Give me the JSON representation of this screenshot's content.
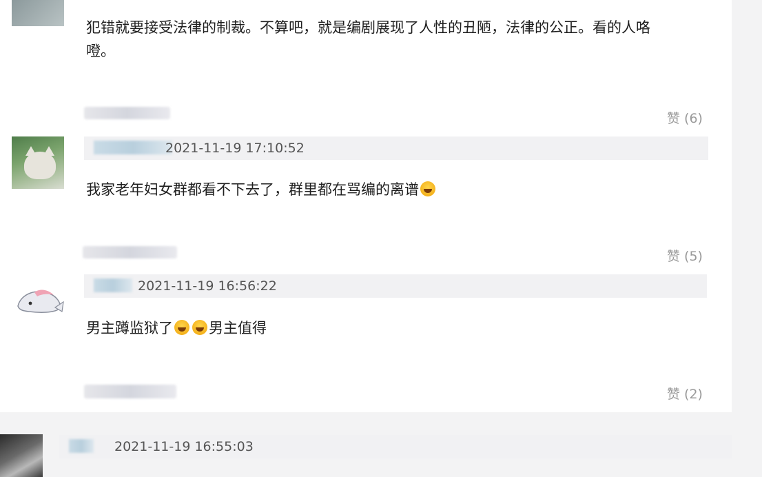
{
  "comments": [
    {
      "text": "犯错就要接受法律的制裁。不算吧，就是编剧展现了人性的丑陋，法律的公正。看的人咯",
      "text_cont": "噔。",
      "likes": "赞 (6)"
    },
    {
      "time": "2021-11-19 17:10:52",
      "text": "我家老年妇女群都看不下去了，群里都在骂编的离谱",
      "likes": "赞 (5)"
    },
    {
      "time": "2021-11-19 16:56:22",
      "text_a": "男主蹲监狱了",
      "text_b": "男主值得",
      "likes": "赞 (2)"
    },
    {
      "time": "2021-11-19 16:55:03"
    }
  ]
}
